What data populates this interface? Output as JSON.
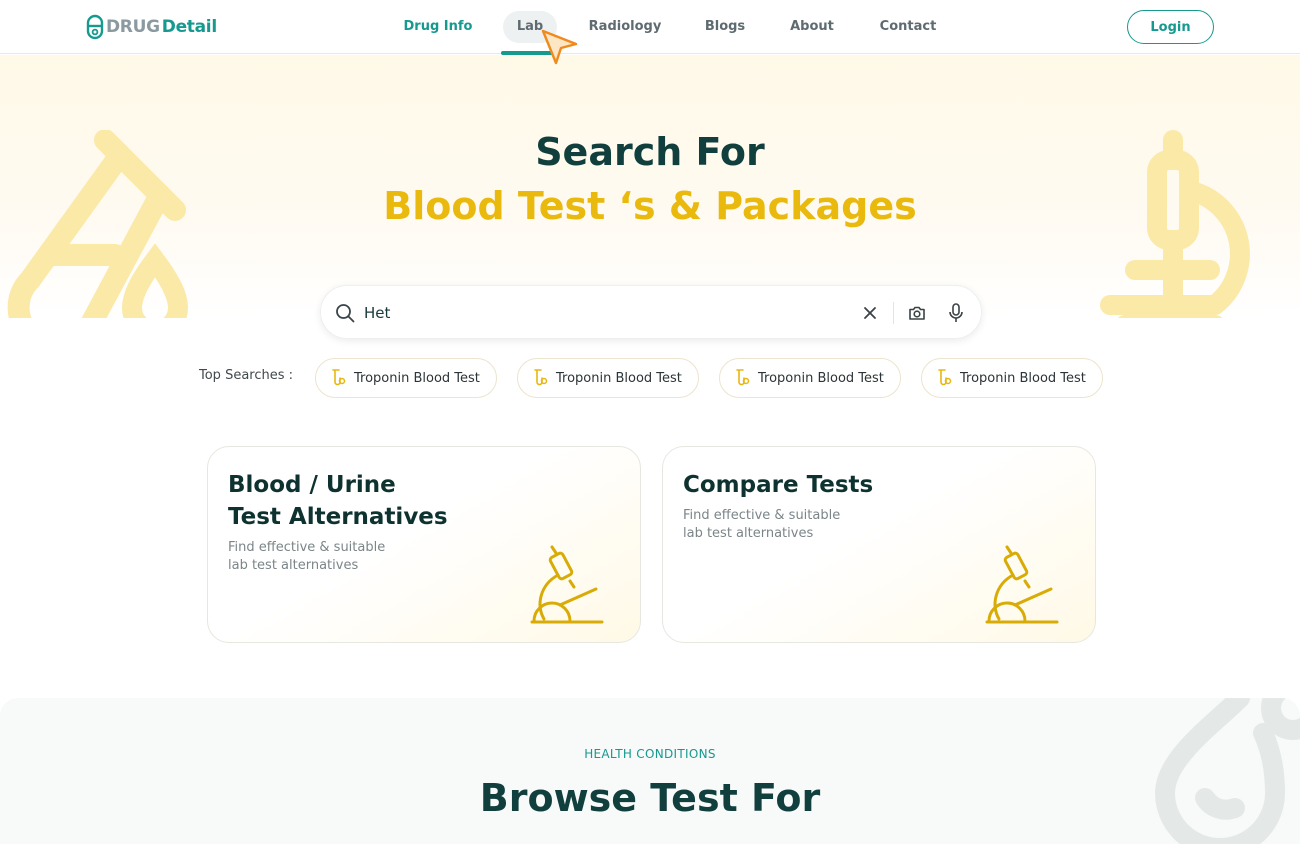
{
  "brand": {
    "name_part1": "DRUG",
    "name_part2": "Detail"
  },
  "nav": {
    "items": [
      {
        "label": "Drug Info"
      },
      {
        "label": "Lab"
      },
      {
        "label": "Radiology"
      },
      {
        "label": "Blogs"
      },
      {
        "label": "About"
      },
      {
        "label": "Contact"
      }
    ],
    "login_label": "Login"
  },
  "hero": {
    "title_line1": "Search For",
    "title_line2": "Blood Test ‘s & Packages"
  },
  "search": {
    "value": "Het"
  },
  "top_searches": {
    "label": "Top Searches :",
    "chips": [
      {
        "label": "Troponin Blood Test"
      },
      {
        "label": "Troponin Blood Test"
      },
      {
        "label": "Troponin Blood Test"
      },
      {
        "label": "Troponin Blood Test"
      }
    ]
  },
  "cards": [
    {
      "title_line1": "Blood / Urine",
      "title_line2": "Test Alternatives",
      "sub_line1": "Find effective & suitable",
      "sub_line2": "lab test alternatives",
      "icon": "microscope-icon"
    },
    {
      "title_line1": "Compare Tests",
      "sub_line1": "Find effective & suitable",
      "sub_line2": "lab test alternatives",
      "icon": "microscope-icon"
    }
  ],
  "conditions": {
    "eyebrow": "HEALTH CONDITIONS",
    "title": "Browse Test For"
  },
  "colors": {
    "brand_green": "#16998f",
    "accent_yellow": "#eab90e",
    "dark_teal": "#103f3d"
  }
}
